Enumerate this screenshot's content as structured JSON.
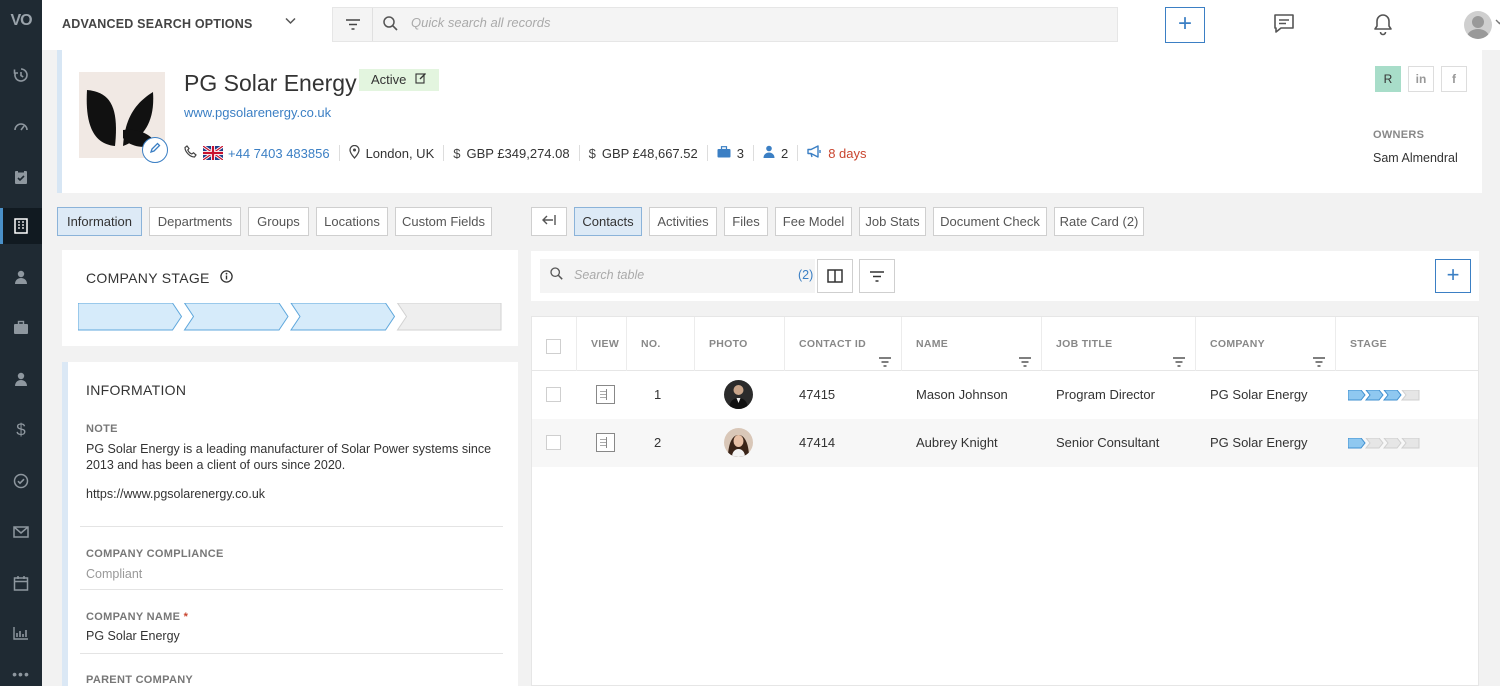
{
  "app": {
    "logo": "VO"
  },
  "topbar": {
    "advanced_search_label": "ADVANCED SEARCH OPTIONS",
    "quick_search_placeholder": "Quick search all records"
  },
  "company": {
    "name": "PG Solar Energy",
    "status": "Active",
    "website": "www.pgsolarenergy.co.uk",
    "phone": "+44 7403 483856",
    "location": "London, UK",
    "amount1": "GBP £349,274.08",
    "amount2": "GBP £48,667.52",
    "jobs_count": "3",
    "contacts_count": "2",
    "last_activity": "8 days",
    "social": {
      "r_label": "R",
      "linkedin_label": "in",
      "facebook_label": "f"
    },
    "owners_label": "OWNERS",
    "owner": "Sam Almendral"
  },
  "left_tabs": [
    {
      "label": "Information",
      "active": true
    },
    {
      "label": "Departments",
      "active": false
    },
    {
      "label": "Groups",
      "active": false
    },
    {
      "label": "Locations",
      "active": false
    },
    {
      "label": "Custom Fields",
      "active": false
    }
  ],
  "right_tabs": [
    {
      "label": "Contacts",
      "active": true
    },
    {
      "label": "Activities",
      "active": false
    },
    {
      "label": "Files",
      "active": false
    },
    {
      "label": "Fee Model",
      "active": false
    },
    {
      "label": "Job Stats",
      "active": false
    },
    {
      "label": "Document Check",
      "active": false
    },
    {
      "label": "Rate Card (2)",
      "active": false
    }
  ],
  "company_stage": {
    "title": "COMPANY STAGE",
    "total_steps": 4,
    "completed_steps": 3
  },
  "information": {
    "title": "INFORMATION",
    "note_label": "NOTE",
    "note_text": "PG Solar Energy is a leading manufacturer of Solar Power systems since 2013 and has been a client of ours since 2020.",
    "note_url": "https://www.pgsolarenergy.co.uk",
    "compliance_label": "COMPANY COMPLIANCE",
    "compliance_value": "Compliant",
    "company_name_label": "COMPANY NAME",
    "company_name_required": "*",
    "company_name_value": "PG Solar Energy",
    "parent_company_label": "PARENT COMPANY"
  },
  "contacts_table": {
    "search_placeholder": "Search table",
    "count": "(2)",
    "columns": [
      "VIEW",
      "NO.",
      "PHOTO",
      "CONTACT ID",
      "NAME",
      "JOB TITLE",
      "COMPANY",
      "STAGE"
    ],
    "rows": [
      {
        "no": "1",
        "contact_id": "47415",
        "name": "Mason Johnson",
        "job_title": "Program Director",
        "company": "PG Solar Energy",
        "stage_completed": 3,
        "stage_total": 4
      },
      {
        "no": "2",
        "contact_id": "47414",
        "name": "Aubrey Knight",
        "job_title": "Senior Consultant",
        "company": "PG Solar Energy",
        "stage_completed": 1,
        "stage_total": 4
      }
    ]
  },
  "colors": {
    "accent": "#3b7fc4",
    "stage_done": "#bfe0f7",
    "stage_todo": "#eeeeee",
    "status_bg": "#e3f5df",
    "warn": "#c9452f"
  }
}
